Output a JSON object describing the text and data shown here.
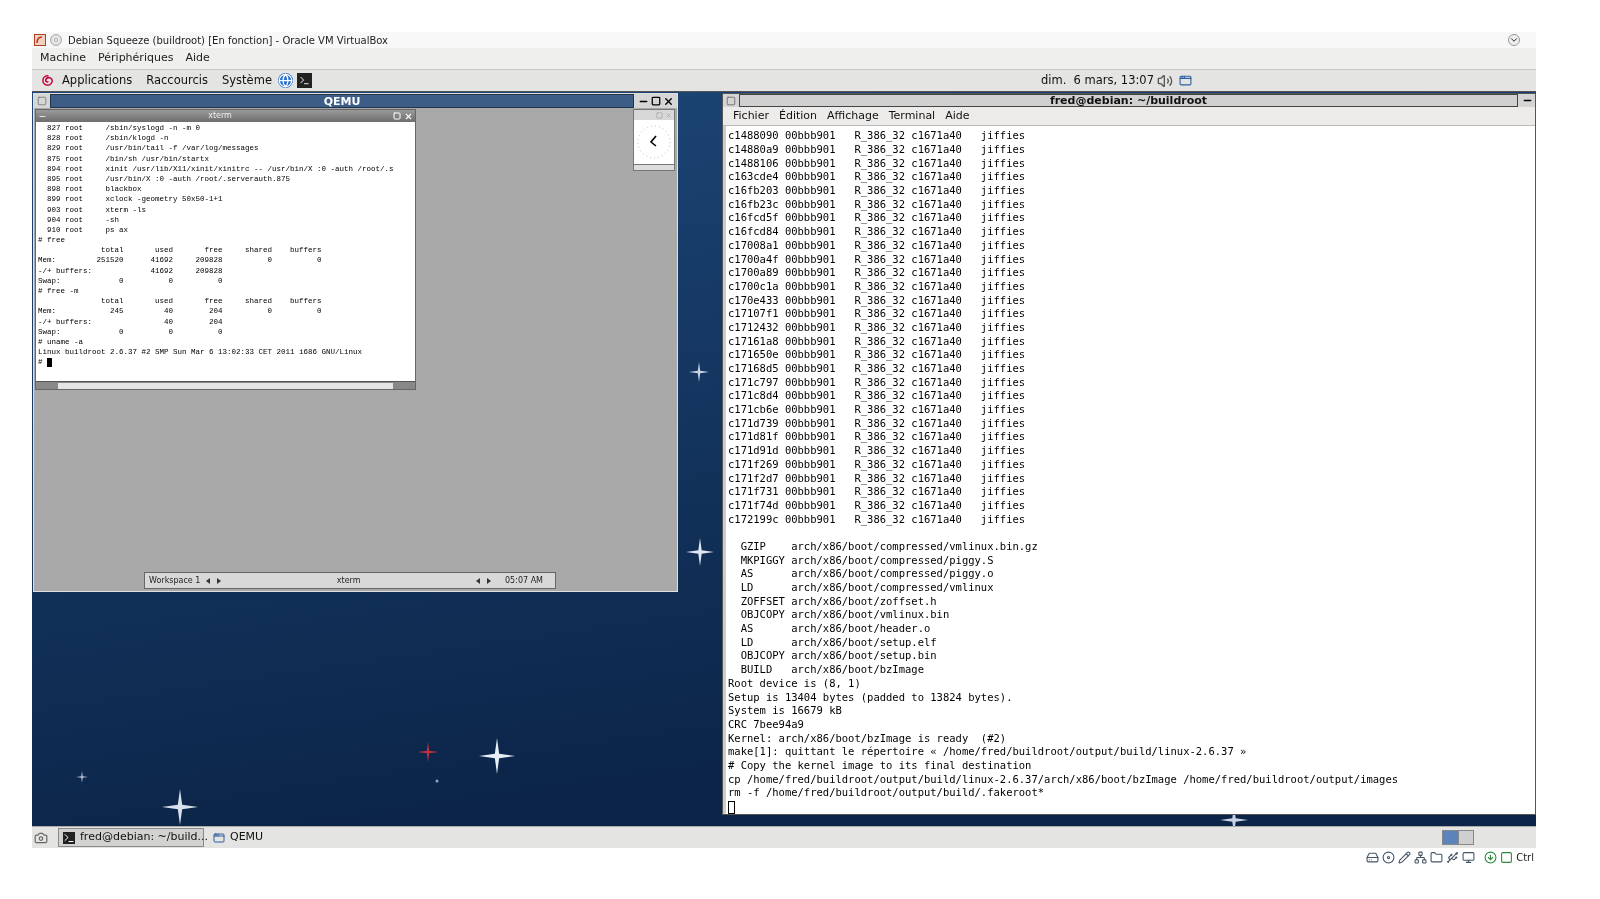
{
  "window": {
    "title": "Debian Squeeze (buildroot) [En fonction] - Oracle VM VirtualBox"
  },
  "menu": [
    "Machine",
    "Périphériques",
    "Aide"
  ],
  "top_panel": {
    "menus": [
      "Applications",
      "Raccourcis",
      "Système"
    ],
    "clock": "dim.  6 mars, 13:07"
  },
  "qemu": {
    "title": "QEMU",
    "xterm": {
      "title": "xterm",
      "lines": [
        "  827 root     /sbin/syslogd -n -m 0",
        "  828 root     /sbin/klogd -n",
        "  829 root     /usr/bin/tail -f /var/log/messages",
        "  875 root     /bin/sh /usr/bin/startx",
        "  894 root     xinit /usr/lib/X11/xinit/xinitrc -- /usr/bin/X :0 -auth /root/.s",
        "  895 root     /usr/bin/X :0 -auth /root/.serverauth.875",
        "  898 root     blackbox",
        "  899 root     xclock -geometry 50x50-1+1",
        "  903 root     xterm -ls",
        "  904 root     -sh",
        "  910 root     ps ax",
        "# free",
        "              total       used       free     shared    buffers",
        "Mem:         251520      41692     209828          0          0",
        "-/+ buffers:             41692     209828",
        "Swap:             0          0          0",
        "# free -m",
        "              total       used       free     shared    buffers",
        "Mem:            245         40        204          0          0",
        "-/+ buffers:                40        204",
        "Swap:             0          0          0",
        "# uname -a",
        "Linux buildroot 2.6.37 #2 SMP Sun Mar 6 13:02:33 CET 2011 i686 GNU/Linux",
        "#"
      ]
    },
    "toolbar": {
      "workspace": "Workspace 1",
      "window": "xterm",
      "time": "05:07 AM"
    }
  },
  "terminal": {
    "title": "fred@debian: ~/buildroot",
    "menu": [
      "Fichier",
      "Édition",
      "Affichage",
      "Terminal",
      "Aide"
    ],
    "symbol_lines": [
      "c1488090 00bbb901   R_386_32 c1671a40   jiffies",
      "c14880a9 00bbb901   R_386_32 c1671a40   jiffies",
      "c1488106 00bbb901   R_386_32 c1671a40   jiffies",
      "c163cde4 00bbb901   R_386_32 c1671a40   jiffies",
      "c16fb203 00bbb901   R_386_32 c1671a40   jiffies",
      "c16fb23c 00bbb901   R_386_32 c1671a40   jiffies",
      "c16fcd5f 00bbb901   R_386_32 c1671a40   jiffies",
      "c16fcd84 00bbb901   R_386_32 c1671a40   jiffies",
      "c17008a1 00bbb901   R_386_32 c1671a40   jiffies",
      "c1700a4f 00bbb901   R_386_32 c1671a40   jiffies",
      "c1700a89 00bbb901   R_386_32 c1671a40   jiffies",
      "c1700c1a 00bbb901   R_386_32 c1671a40   jiffies",
      "c170e433 00bbb901   R_386_32 c1671a40   jiffies",
      "c17107f1 00bbb901   R_386_32 c1671a40   jiffies",
      "c1712432 00bbb901   R_386_32 c1671a40   jiffies",
      "c17161a8 00bbb901   R_386_32 c1671a40   jiffies",
      "c171650e 00bbb901   R_386_32 c1671a40   jiffies",
      "c17168d5 00bbb901   R_386_32 c1671a40   jiffies",
      "c171c797 00bbb901   R_386_32 c1671a40   jiffies",
      "c171c8d4 00bbb901   R_386_32 c1671a40   jiffies",
      "c171cb6e 00bbb901   R_386_32 c1671a40   jiffies",
      "c171d739 00bbb901   R_386_32 c1671a40   jiffies",
      "c171d81f 00bbb901   R_386_32 c1671a40   jiffies",
      "c171d91d 00bbb901   R_386_32 c1671a40   jiffies",
      "c171f269 00bbb901   R_386_32 c1671a40   jiffies",
      "c171f2d7 00bbb901   R_386_32 c1671a40   jiffies",
      "c171f731 00bbb901   R_386_32 c1671a40   jiffies",
      "c171f74d 00bbb901   R_386_32 c1671a40   jiffies",
      "c172199c 00bbb901   R_386_32 c1671a40   jiffies"
    ],
    "build_lines": [
      "  GZIP    arch/x86/boot/compressed/vmlinux.bin.gz",
      "  MKPIGGY arch/x86/boot/compressed/piggy.S",
      "  AS      arch/x86/boot/compressed/piggy.o",
      "  LD      arch/x86/boot/compressed/vmlinux",
      "  ZOFFSET arch/x86/boot/zoffset.h",
      "  OBJCOPY arch/x86/boot/vmlinux.bin",
      "  AS      arch/x86/boot/header.o",
      "  LD      arch/x86/boot/setup.elf",
      "  OBJCOPY arch/x86/boot/setup.bin",
      "  BUILD   arch/x86/boot/bzImage",
      "Root device is (8, 1)",
      "Setup is 13404 bytes (padded to 13824 bytes).",
      "System is 16679 kB",
      "CRC 7bee94a9",
      "Kernel: arch/x86/boot/bzImage is ready  (#2)",
      "make[1]: quittant le répertoire « /home/fred/buildroot/output/build/linux-2.6.37 »",
      "# Copy the kernel image to its final destination",
      "cp /home/fred/buildroot/output/build/linux-2.6.37/arch/x86/boot/bzImage /home/fred/buildroot/output/images",
      "rm -f /home/fred/buildroot/output/build/.fakeroot*"
    ]
  },
  "taskbar": {
    "tasks": [
      {
        "label": "fred@debian: ~/build...",
        "selected": true
      },
      {
        "label": "QEMU",
        "selected": false
      }
    ]
  },
  "status_bar": {
    "host_key": "Ctrl"
  }
}
